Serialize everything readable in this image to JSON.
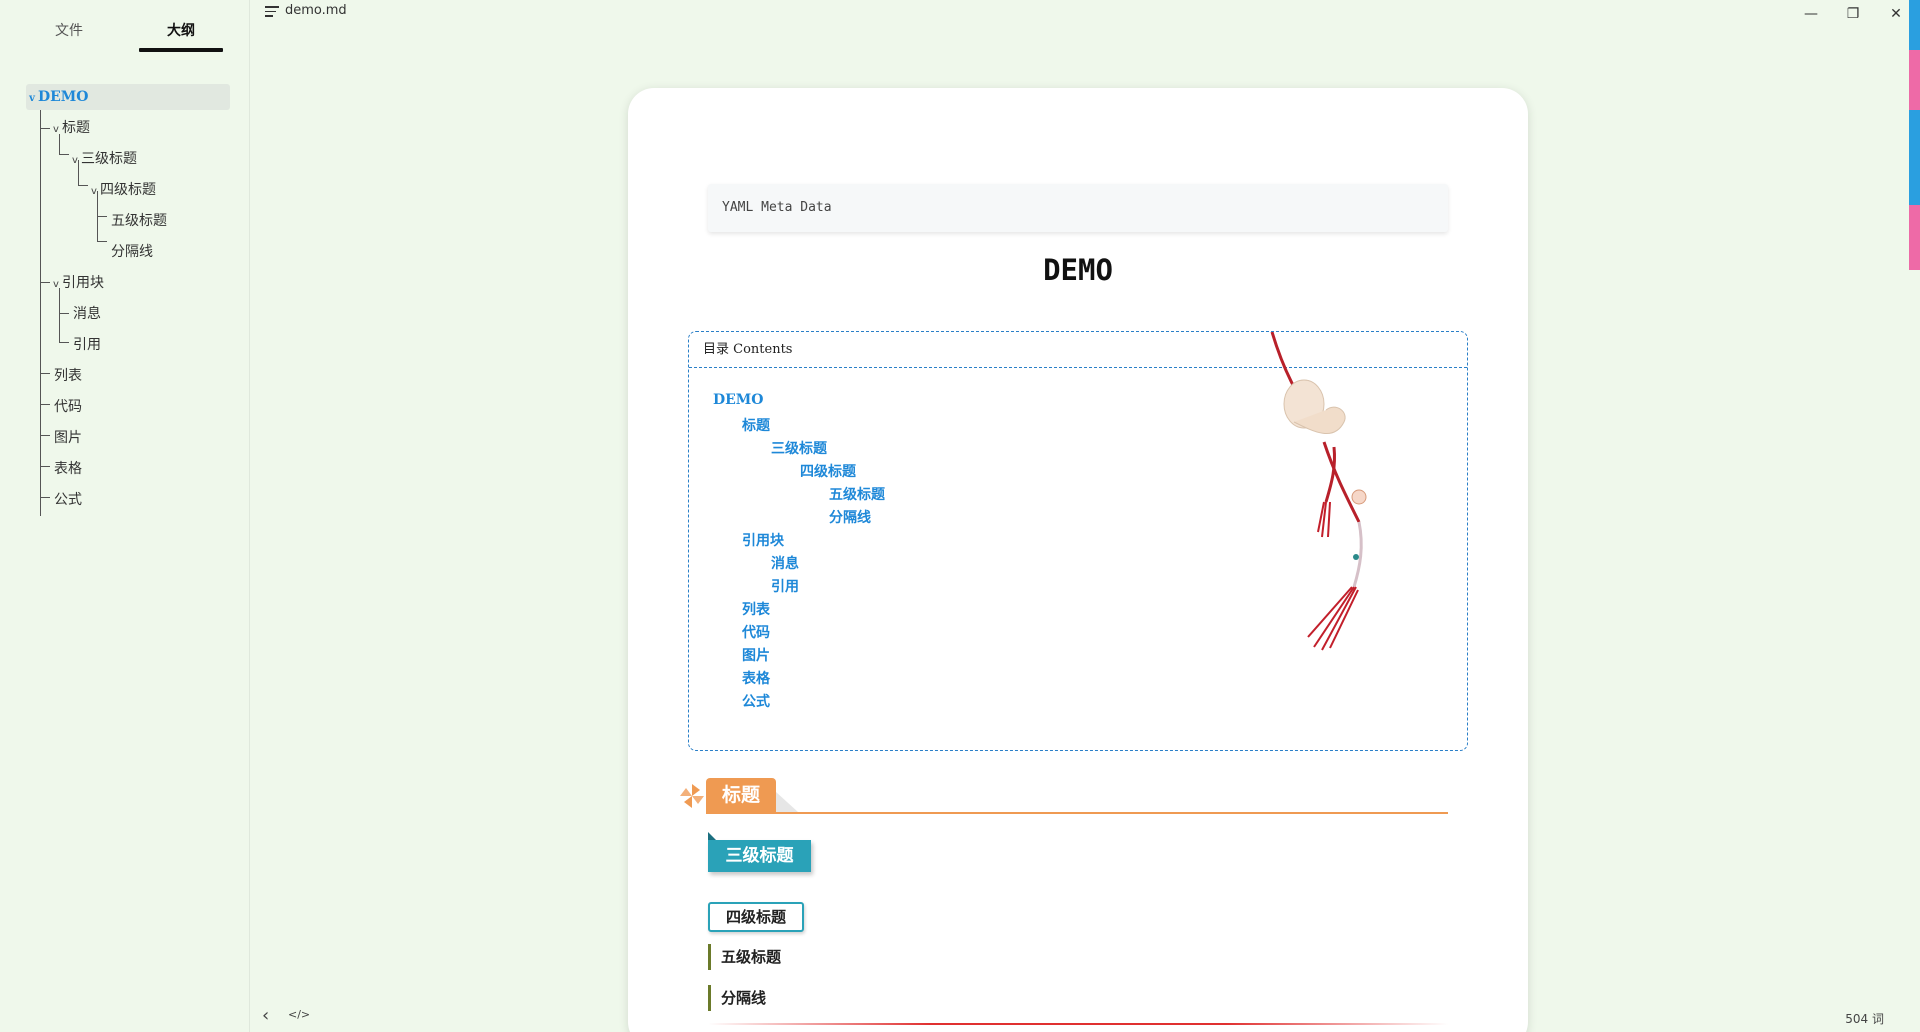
{
  "sidebar": {
    "tabs": [
      {
        "label": "文件"
      },
      {
        "label": "大纲"
      }
    ],
    "outline": [
      {
        "label": "DEMO"
      },
      {
        "label": "标题"
      },
      {
        "label": "三级标题"
      },
      {
        "label": "四级标题"
      },
      {
        "label": "五级标题"
      },
      {
        "label": "分隔线"
      },
      {
        "label": "引用块"
      },
      {
        "label": "消息"
      },
      {
        "label": "引用"
      },
      {
        "label": "列表"
      },
      {
        "label": "代码"
      },
      {
        "label": "图片"
      },
      {
        "label": "表格"
      },
      {
        "label": "公式"
      }
    ]
  },
  "titlebar": {
    "filename": "demo.md",
    "minimize": "—",
    "restore": "❐",
    "close": "✕"
  },
  "document": {
    "yaml_label": "YAML Meta Data",
    "title": "DEMO",
    "toc": {
      "header": "目录 Contents",
      "items": [
        {
          "label": "DEMO"
        },
        {
          "label": "标题"
        },
        {
          "label": "三级标题"
        },
        {
          "label": "四级标题"
        },
        {
          "label": "五级标题"
        },
        {
          "label": "分隔线"
        },
        {
          "label": "引用块"
        },
        {
          "label": "消息"
        },
        {
          "label": "引用"
        },
        {
          "label": "列表"
        },
        {
          "label": "代码"
        },
        {
          "label": "图片"
        },
        {
          "label": "表格"
        },
        {
          "label": "公式"
        }
      ]
    },
    "h2": "标题",
    "h3": "三级标题",
    "h4": "四级标题",
    "h5": "五级标题",
    "h5_separator": "分隔线"
  },
  "statusbar": {
    "toggle_sidebar": "‹",
    "source_mode": "</>",
    "word_count": "504 词"
  },
  "colors": {
    "background": "#eff8eb",
    "link": "#1e88d8",
    "h2": "#ef9a52",
    "h3": "#2aa2b8"
  }
}
